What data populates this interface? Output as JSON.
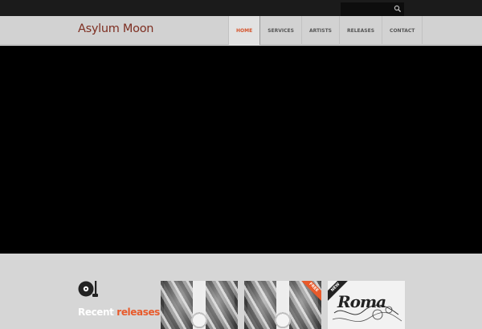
{
  "topbar": {
    "search": {
      "value": "",
      "placeholder": "",
      "icon": "search-icon"
    }
  },
  "header": {
    "logo": "Asylum Moon",
    "nav": [
      {
        "label": "HOME",
        "active": true
      },
      {
        "label": "SERVICES",
        "active": false
      },
      {
        "label": "ARTISTS",
        "active": false
      },
      {
        "label": "RELEASES",
        "active": false
      },
      {
        "label": "CONTACT",
        "active": false
      }
    ]
  },
  "hero": {
    "color": "#000000"
  },
  "releases": {
    "icon": "vinyl-record-icon",
    "title_word1": "Recent",
    "title_word2": "releases.",
    "items": [
      {
        "ribbon": ""
      },
      {
        "ribbon": "FREE"
      },
      {
        "ribbon": "NEW",
        "art_text": "Roma"
      }
    ]
  },
  "colors": {
    "accent": "#e85a2b",
    "logo": "#7e2f22",
    "topbar": "#1b1b1b",
    "header": "#d2d2d2"
  }
}
